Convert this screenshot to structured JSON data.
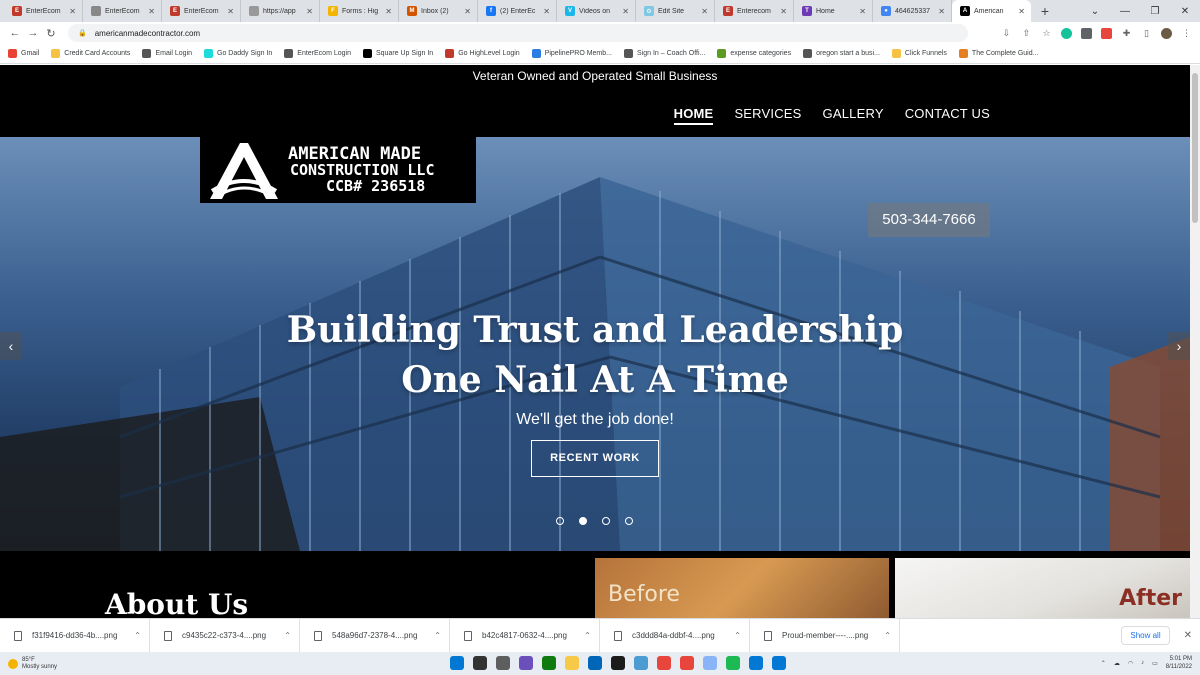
{
  "browser": {
    "tabs": [
      {
        "label": "EnterEcom",
        "color": "#c0392b",
        "glyph": "E"
      },
      {
        "label": "EnterEcom",
        "color": "#888888",
        "glyph": ""
      },
      {
        "label": "EnterEcom",
        "color": "#c0392b",
        "glyph": "E"
      },
      {
        "label": "https://app",
        "color": "#999999",
        "glyph": ""
      },
      {
        "label": "Forms : Hig",
        "color": "#f4b400",
        "glyph": "F"
      },
      {
        "label": "Inbox (2)",
        "color": "#d35400",
        "glyph": "M"
      },
      {
        "label": "(2) EnterEc",
        "color": "#1877f2",
        "glyph": "f"
      },
      {
        "label": "Videos on",
        "color": "#1ab7ea",
        "glyph": "V"
      },
      {
        "label": "Edit Site",
        "color": "#7ec8e3",
        "glyph": "⚙"
      },
      {
        "label": "Enterecom",
        "color": "#c0392b",
        "glyph": "E"
      },
      {
        "label": "Home",
        "color": "#6d3bb5",
        "glyph": "T"
      },
      {
        "label": "464625337",
        "color": "#4285f4",
        "glyph": "●"
      },
      {
        "label": "American",
        "color": "#000000",
        "glyph": "A"
      }
    ],
    "new_tab": "+",
    "window_controls": [
      "⌄",
      "—",
      "❐",
      "✕"
    ],
    "url": "americanmadecontractor.com",
    "nav": {
      "back": "←",
      "forward": "→",
      "reload": "↻"
    },
    "bookmarks": [
      {
        "label": "Gmail",
        "color": "#ea4335"
      },
      {
        "label": "Credit Card Accounts",
        "color": "#f6c244"
      },
      {
        "label": "Email Login",
        "color": "#555555"
      },
      {
        "label": "Go Daddy Sign In",
        "color": "#1bdbdb"
      },
      {
        "label": "EnterEcom Login",
        "color": "#555555"
      },
      {
        "label": "Square Up Sign In",
        "color": "#000000"
      },
      {
        "label": "Go HighLevel Login",
        "color": "#c0392b"
      },
      {
        "label": "PipelinePRO Memb...",
        "color": "#2a7de1"
      },
      {
        "label": "Sign In – Coach Offi...",
        "color": "#555555"
      },
      {
        "label": "expense categories",
        "color": "#5b9a23"
      },
      {
        "label": "oregon start a busi...",
        "color": "#555555"
      },
      {
        "label": "Click Funnels",
        "color": "#f6c244"
      },
      {
        "label": "The Complete Guid...",
        "color": "#e67e22"
      }
    ]
  },
  "site": {
    "top_strip": "Veteran Owned and Operated Small Business",
    "menu": [
      {
        "label": "HOME",
        "active": true
      },
      {
        "label": "SERVICES",
        "active": false
      },
      {
        "label": "GALLERY",
        "active": false
      },
      {
        "label": "CONTACT US",
        "active": false
      }
    ],
    "logo": {
      "line1": "AMERICAN MADE",
      "line2": "CONSTRUCTION LLC",
      "line3": "CCB# 236518"
    },
    "phone": "503-344-7666",
    "headline_line1": "Building Trust and Leadership",
    "headline_line2": "One Nail At A Time",
    "subline": "We'll get the job done!",
    "cta": "RECENT WORK",
    "slider": {
      "count": 4,
      "active_index": 1,
      "prev": "‹",
      "next": "›"
    },
    "about_title": "About Us",
    "before_label": "Before",
    "after_label": "After"
  },
  "downloads": {
    "items": [
      "f31f9416-dd36-4b....png",
      "c9435c22-c373-4....png",
      "548a96d7-2378-4....png",
      "b42c4817-0632-4....png",
      "c3ddd84a-ddbf-4....png",
      "Proud-member----....png"
    ],
    "show_all": "Show all",
    "close": "✕"
  },
  "taskbar": {
    "temp": "85°F",
    "condition": "Mostly sunny",
    "time": "5:01 PM",
    "date": "8/11/2022",
    "app_colors": [
      "#0078d4",
      "#333333",
      "#5e5e5e",
      "#6b4fbb",
      "#0f7b0f",
      "#f7c948",
      "#0067b8",
      "#1b1b1b",
      "#4b9cd3",
      "#e8453c",
      "#e8453c",
      "#8ab4f8",
      "#1db954",
      "#0078d4",
      "#0078d4"
    ]
  }
}
